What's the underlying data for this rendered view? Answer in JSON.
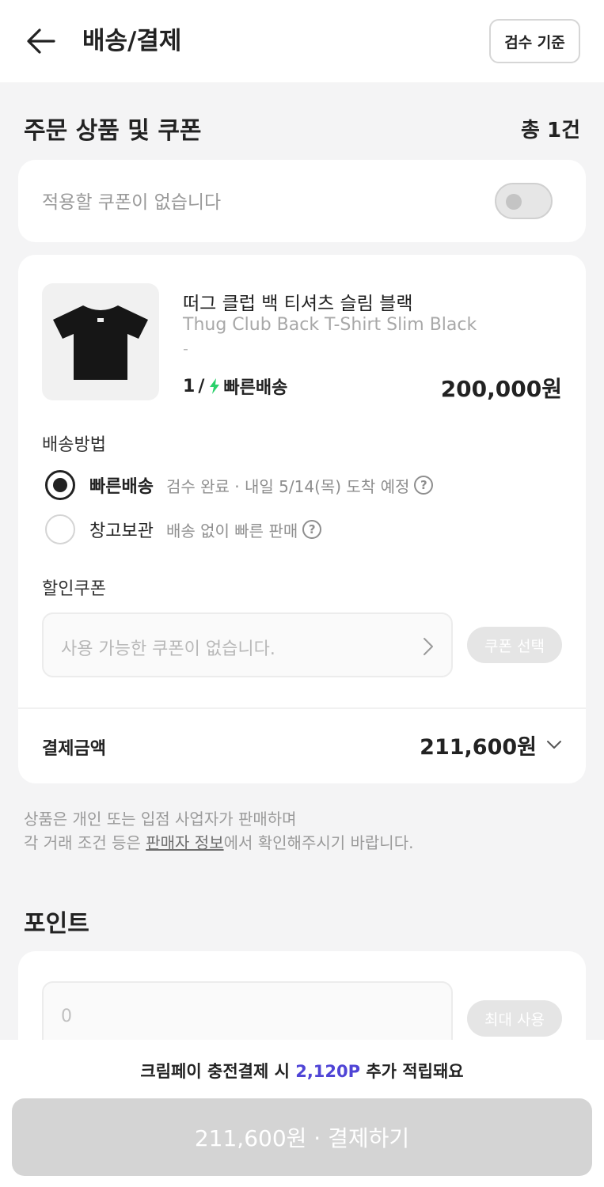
{
  "header": {
    "title": "배송/결제",
    "inspect_button": "검수 기준"
  },
  "order_section": {
    "title": "주문 상품 및 쿠폰",
    "count": "총 1건"
  },
  "coupon_toggle": {
    "text": "적용할 쿠폰이 없습니다",
    "enabled": false
  },
  "product": {
    "name_ko": "떠그 클럽 백 티셔츠 슬림 블랙",
    "name_en": "Thug Club Back T-Shirt Slim Black",
    "option": "-",
    "quantity": "1",
    "fast_label": "빠른배송",
    "price": "200,000원"
  },
  "shipping": {
    "label": "배송방법",
    "options": [
      {
        "name": "빠른배송",
        "desc": "검수 완료 · 내일 5/14(목) 도착 예정",
        "selected": true
      },
      {
        "name": "창고보관",
        "desc": "배송 없이 빠른 판매",
        "selected": false
      }
    ],
    "help_glyph": "?"
  },
  "discount": {
    "label": "할인쿠폰",
    "placeholder": "사용 가능한 쿠폰이 없습니다.",
    "button": "쿠폰 선택"
  },
  "payment": {
    "label": "결제금액",
    "amount": "211,600원"
  },
  "notice": {
    "line1": "상품은 개인 또는 입점 사업자가 판매하며",
    "line2_prefix": "각 거래 조건 등은 ",
    "line2_link": "판매자 정보",
    "line2_suffix": "에서 확인해주시기 바랍니다."
  },
  "points": {
    "title": "포인트",
    "value": "0",
    "button": "최대 사용"
  },
  "bottom": {
    "msg_prefix": "크림페이 충전결제 시 ",
    "msg_points": "2,120P",
    "msg_suffix": " 추가 적립돼요",
    "pay_button": "211,600원 · 결제하기"
  },
  "colors": {
    "accent_points": "#4f44d6",
    "fast_bolt": "#2ad16a",
    "disabled_button": "#d4d4d4"
  }
}
